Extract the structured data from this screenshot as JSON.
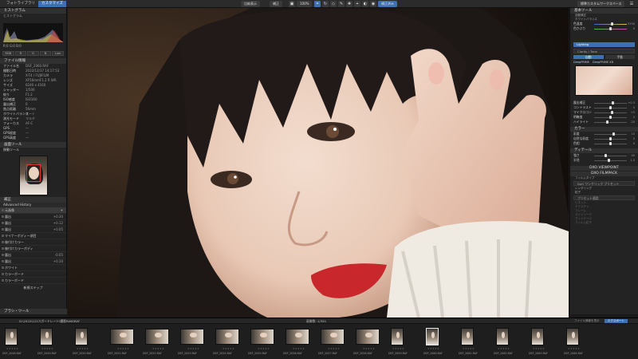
{
  "topbar": {
    "tabs": [
      "フォトライブラリ",
      "カスタマイズ",
      "補正"
    ],
    "center_buttons": [
      "比較表示",
      "補正"
    ],
    "zoom": "100%",
    "right_button": "補正済み",
    "workspace": "標準カスタムワークスペース"
  },
  "left_panel": {
    "histogram_title": "ヒストグラム",
    "histogram_sub": "ヒストグラム",
    "rgb_readout": "R:0   G:0   B:0",
    "channel_buttons": [
      "RGB",
      "R",
      "G",
      "B",
      "Lum"
    ],
    "file_info_title": "ファイル情報",
    "info_rows": [
      {
        "label": "ファイル名",
        "value": "DSF_2060.RAF"
      },
      {
        "label": "撮影日時",
        "value": "2022/12/17 14:17:53"
      },
      {
        "label": "カメラ",
        "value": "X-T4 / FUJIFILM"
      },
      {
        "label": "レンズ",
        "value": "XF56mmF1.2 R WR"
      },
      {
        "label": "サイズ",
        "value": "6240 x 4160"
      },
      {
        "label": "シャッター",
        "value": "1/500"
      },
      {
        "label": "絞り",
        "value": "F1.2"
      },
      {
        "label": "ISO感度",
        "value": "ISO160"
      },
      {
        "label": "露出補正",
        "value": "0"
      },
      {
        "label": "焦点距離",
        "value": "56mm"
      },
      {
        "label": "ホワイトバランス",
        "value": "オート"
      },
      {
        "label": "測光モード",
        "value": "マルチ"
      },
      {
        "label": "フォーカス",
        "value": "AF-C"
      },
      {
        "label": "GPS",
        "value": "—"
      },
      {
        "label": "GPS経度",
        "value": "—"
      },
      {
        "label": "GPS高度",
        "value": "—"
      }
    ],
    "navigator_title": "画面ツール",
    "navigator_sub": "移動ツール",
    "layers_title": "補正",
    "layers_header": "Advanced History",
    "layer_rows": [
      {
        "label": "元画像",
        "value": "+"
      },
      {
        "label": "露出",
        "value": "+0.30"
      },
      {
        "label": "露出",
        "value": "+0.12"
      },
      {
        "label": "露出",
        "value": "+0.05"
      },
      {
        "label": "マイナーボディー項目",
        "value": ""
      },
      {
        "label": "後付けカラー",
        "value": ""
      },
      {
        "label": "後付けカラーボディ",
        "value": ""
      },
      {
        "label": "露出",
        "value": "-0.05"
      },
      {
        "label": "露出",
        "value": "+0.10"
      },
      {
        "label": "ホワイト",
        "value": ""
      },
      {
        "label": "カラーボード",
        "value": ""
      },
      {
        "label": "カラーボード",
        "value": ""
      },
      {
        "label": "カラーボード",
        "value": ""
      },
      {
        "label": "カラーボード",
        "value": ""
      }
    ],
    "apply_button": "新規ステップ",
    "footer": "ブラシ・ツール"
  },
  "right_panel": {
    "section_basic": "基本ツール",
    "sub_rows": [
      "自動補正",
      "ホワイトバランス"
    ],
    "sliders_top": [
      {
        "label": "色温度",
        "value": "5700",
        "pos": 0.55
      },
      {
        "label": "色かぶり",
        "value": "0",
        "pos": 0.5
      }
    ],
    "blue_bar": "Lighting",
    "grey_bar": "Clarity / Tone",
    "mode_left": "自動",
    "mode_right": "手動",
    "radio_a": "DeepPRIME",
    "radio_b": "DeepPRIME XD",
    "sliders_mid": [
      {
        "label": "露出補正",
        "value": "+0.3",
        "pos": 0.58
      },
      {
        "label": "コントラスト",
        "value": "0",
        "pos": 0.5
      },
      {
        "label": "マイクロコントラスト",
        "value": "+5",
        "pos": 0.55
      },
      {
        "label": "明瞭度",
        "value": "0",
        "pos": 0.5
      },
      {
        "label": "ハイライト",
        "value": "-20",
        "pos": 0.4
      }
    ],
    "section_color": "カラー",
    "sliders_color": [
      {
        "label": "彩度",
        "value": "10",
        "pos": 0.6
      },
      {
        "label": "自然な彩度",
        "value": "0",
        "pos": 0.5
      },
      {
        "label": "色相",
        "value": "0",
        "pos": 0.5
      }
    ],
    "section_detail": "ディテール",
    "sliders_detail": [
      {
        "label": "強さ",
        "value": "40",
        "pos": 0.35
      },
      {
        "label": "半径",
        "value": "1.0",
        "pos": 0.45
      }
    ],
    "viewpoint": "DXO VIEWPOINT",
    "filmpack": "DXO FILMPACK",
    "film_rows": [
      "フィルムタイプ",
      "レンダリング",
      "粒子"
    ],
    "film_sel": "DxO ワンクリック プリセット",
    "preset_bar": "プリセット適用",
    "dim_rows": [
      "ビネット",
      "テクスチャ",
      "フレーム",
      "ライトリーク",
      "ヴィンテージ",
      "フィルム粒子"
    ]
  },
  "filmstrip": {
    "path": "D:\\2022\\1217\\ポートレート\\撮影RAW\\RAF",
    "count": "画像数: 1/354",
    "right_label": "ファイル情報を表示",
    "export_button": "エクスポート",
    "items": [
      {
        "name": "DSF_2048.RAF",
        "wide": false
      },
      {
        "name": "DSF_2049.RAF",
        "wide": false
      },
      {
        "name": "DSF_2050.RAF",
        "wide": false
      },
      {
        "name": "DSF_2051.RAF",
        "wide": true
      },
      {
        "name": "DSF_2052.RAF",
        "wide": true
      },
      {
        "name": "DSF_2053.RAF",
        "wide": true
      },
      {
        "name": "DSF_2054.RAF",
        "wide": true
      },
      {
        "name": "DSF_2055.RAF",
        "wide": true
      },
      {
        "name": "DSF_2056.RAF",
        "wide": true
      },
      {
        "name": "DSF_2057.RAF",
        "wide": true
      },
      {
        "name": "DSF_2058.RAF",
        "wide": true
      },
      {
        "name": "DSF_2059.RAF",
        "wide": false
      },
      {
        "name": "DSF_2060.RAF",
        "wide": false
      },
      {
        "name": "DSF_2061.RAF",
        "wide": false
      },
      {
        "name": "DSF_2062.RAF",
        "wide": false
      },
      {
        "name": "DSF_2063.RAF",
        "wide": false
      },
      {
        "name": "DSF_2064.RAF",
        "wide": false
      }
    ]
  },
  "colors": {
    "accent": "#3d6fb2",
    "panel": "#232323",
    "lips": "#c8282c"
  }
}
